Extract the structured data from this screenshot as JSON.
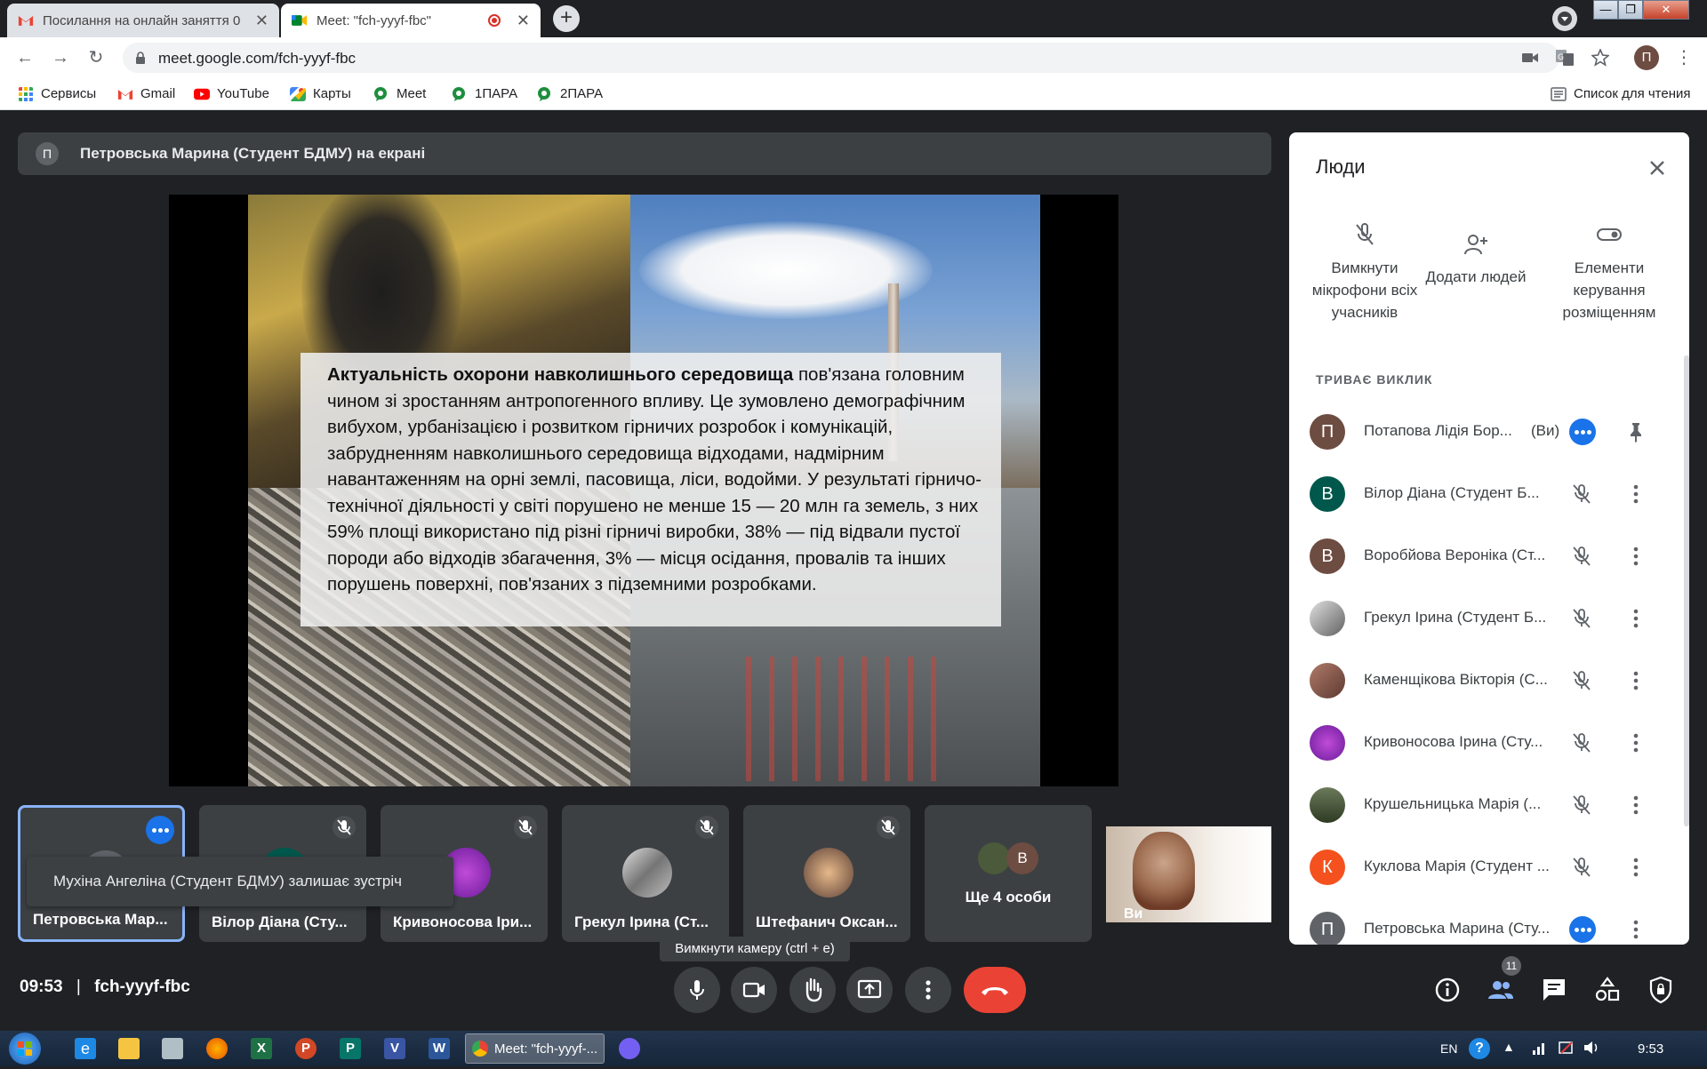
{
  "browser": {
    "tabs": [
      {
        "title": "Посилання на онлайн заняття 0",
        "icon": "gmail-icon"
      },
      {
        "title": "Meet: \"fch-yyyf-fbc\"",
        "icon": "meet-icon",
        "recording": true
      }
    ],
    "url": "meet.google.com/fch-yyyf-fbc",
    "profile_initial": "П",
    "bookmarks": [
      {
        "label": "Сервисы",
        "icon": "apps-grid-icon"
      },
      {
        "label": "Gmail",
        "icon": "gmail-icon"
      },
      {
        "label": "YouTube",
        "icon": "youtube-icon"
      },
      {
        "label": "Карты",
        "icon": "maps-icon"
      },
      {
        "label": "Meet",
        "icon": "meet-bookmark-icon"
      },
      {
        "label": "1ПАРА",
        "icon": "meet-bookmark-icon"
      },
      {
        "label": "2ПАРА",
        "icon": "meet-bookmark-icon"
      }
    ],
    "reading_list": "Список для чтения"
  },
  "meet": {
    "presenter_badge": "П",
    "presenter_banner": "Петровська Марина (Студент БДМУ) на екрані",
    "slide": {
      "bold_lead": "Актуальність охорони навколишнього середовища",
      "body": " пов'язана головним чином зі зростанням антропогенного впливу. Це зумовлено демографічним вибухом, урбанізацією і розвитком гірничих розробок і комунікацій, забрудненням навколишнього середовища відходами, надмірним навантаженням на орні землі, пасовища, ліси, водойми. У результаті гірничо-технічної діяльності у світі порушено не менше 15 — 20 млн га земель, з них 59% площі використано під різні гірничі виробки, 38% — під відвали пустої породи або відходів збагачення, 3% — місця осідання, провалів та інших порушень поверхні, пов'язаних з підземними розробками."
    },
    "tiles": [
      {
        "name": "Петровська Мар...",
        "state": "more"
      },
      {
        "name": "Вілор Діана (Сту...",
        "state": "muted"
      },
      {
        "name": "Кривоносова Іри...",
        "state": "muted"
      },
      {
        "name": "Грекул Ірина (Ст...",
        "state": "muted"
      },
      {
        "name": "Штефанич Оксан...",
        "state": "muted"
      }
    ],
    "more_tile": {
      "label": "Ще 4 особи",
      "initial": "В"
    },
    "self_tile": {
      "label": "Ви"
    },
    "toast": "Мухіна Ангеліна (Студент БДМУ) залишає зустріч",
    "tooltip": "Вимкнути камеру (ctrl + e)",
    "time": "09:53",
    "separator": "|",
    "meeting_code": "fch-yyyf-fbc",
    "participant_count": "11"
  },
  "people_panel": {
    "title": "Люди",
    "actions": [
      {
        "label": "Вимкнути мікрофони всіх учасників"
      },
      {
        "label": "Додати людей"
      },
      {
        "label": "Елементи керування розміщенням"
      }
    ],
    "section": "ТРИВАЄ ВИКЛИК",
    "you_label": "(Ви)",
    "participants": [
      {
        "name": "Потапова Лідія Бор...",
        "initial": "П",
        "color": "#6d4c41",
        "you": true
      },
      {
        "name": "Вілор Діана (Студент Б...",
        "initial": "В",
        "color": "#00574b"
      },
      {
        "name": "Воробйова Вероніка (Ст...",
        "initial": "В",
        "color": "#6d4c41"
      },
      {
        "name": "Грекул Ірина (Студент Б...",
        "initial": "",
        "color": "#9e9e9e"
      },
      {
        "name": "Каменщікова Вікторія (С...",
        "initial": "",
        "color": "#8d5a4e"
      },
      {
        "name": "Кривоносова Ірина (Сту...",
        "initial": "",
        "color": "#8e24aa"
      },
      {
        "name": "Крушельницька Марія (...",
        "initial": "",
        "color": "#4a5a3a"
      },
      {
        "name": "Куклова Марія (Студент ...",
        "initial": "К",
        "color": "#f4511e"
      },
      {
        "name": "Петровська Марина (Сту...",
        "initial": "П",
        "color": "#5f6368",
        "active": true
      }
    ]
  },
  "taskbar": {
    "chrome_label": "Meet: \"fch-yyyf-...",
    "lang": "EN",
    "time": "9:53"
  }
}
